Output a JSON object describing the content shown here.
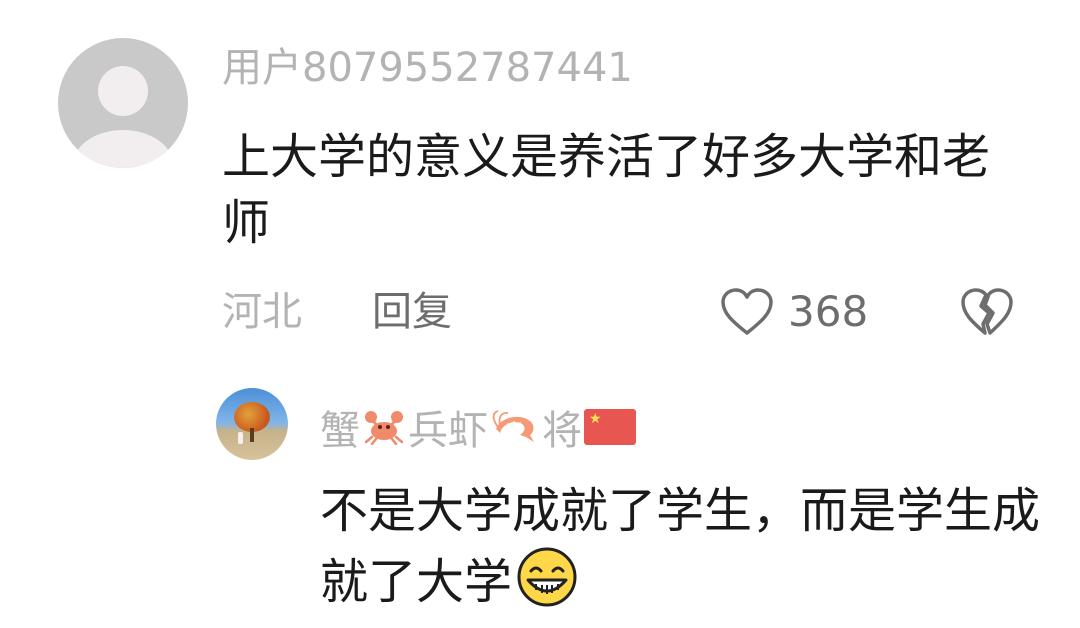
{
  "comment": {
    "username": "用户8079552787441",
    "text": "上大学的意义是养活了好多大学和老师",
    "location": "河北",
    "reply_label": "回复",
    "like_count": "368"
  },
  "reply": {
    "username_parts": [
      "蟹",
      "兵虾",
      "将"
    ],
    "text": "不是大学成就了学生，而是学生成就了大学"
  },
  "icons": {
    "like": "heart-outline-icon",
    "dislike": "broken-heart-icon",
    "username_emojis": [
      "crab-emoji-icon",
      "shrimp-emoji-icon",
      "china-flag-icon"
    ],
    "text_emoji": "grinning-face-icon"
  },
  "colors": {
    "username": "#b3b3b3",
    "body_text": "#1a1a1a",
    "action_text": "#6d6d6d"
  }
}
